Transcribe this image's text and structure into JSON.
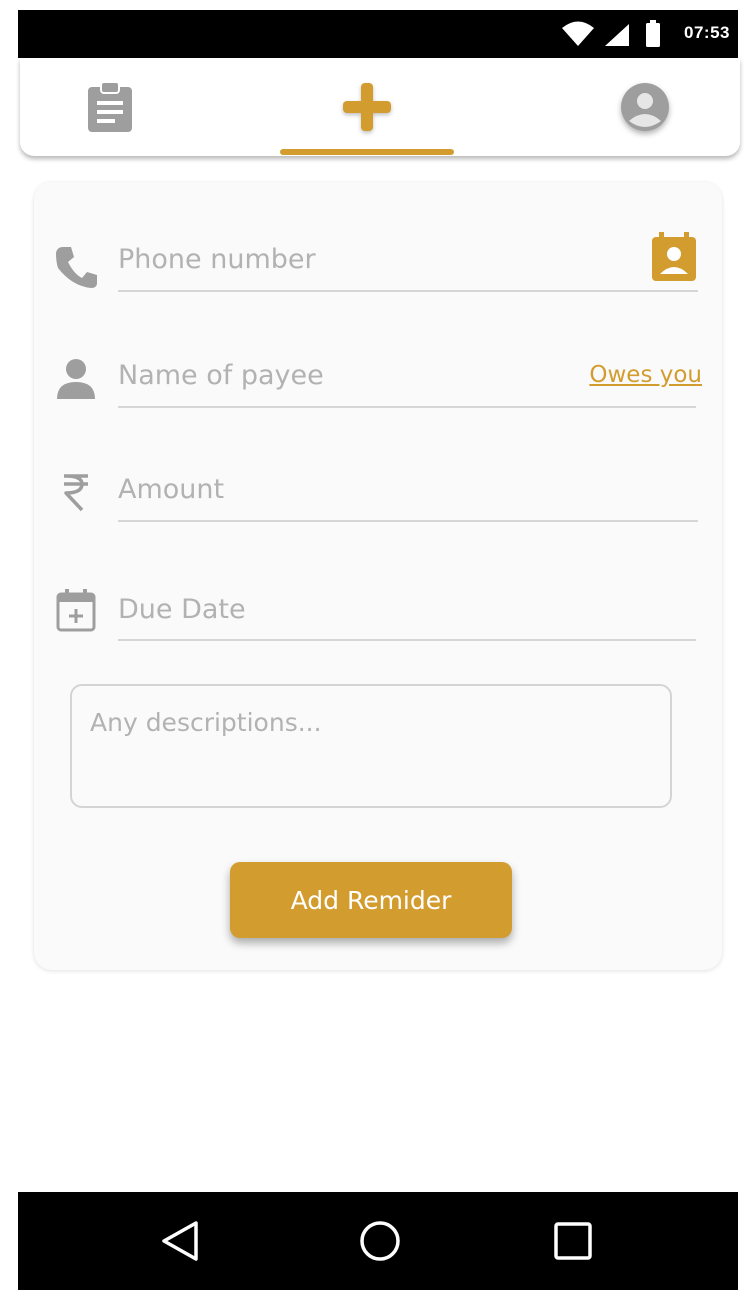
{
  "colors": {
    "accent": "#D39C2F",
    "icon_gray": "#9E9E9E",
    "placeholder": "#B2B2B2"
  },
  "status_bar": {
    "time": "07:53",
    "icons": [
      "wifi-icon",
      "signal-icon",
      "battery-icon"
    ]
  },
  "tabs": [
    {
      "name": "reminders",
      "icon": "clipboard-icon",
      "active": false
    },
    {
      "name": "add",
      "icon": "plus-icon",
      "active": true
    },
    {
      "name": "profile",
      "icon": "account-circle-icon",
      "active": false
    }
  ],
  "form": {
    "phone": {
      "placeholder": "Phone number",
      "icon": "phone-icon",
      "action_icon": "contact-book-icon"
    },
    "payee": {
      "placeholder": "Name of payee",
      "icon": "person-icon",
      "toggle_label": "Owes you"
    },
    "amount": {
      "placeholder": "Amount",
      "icon": "rupee-icon"
    },
    "due_date": {
      "placeholder": "Due Date",
      "icon": "calendar-plus-icon"
    },
    "description": {
      "placeholder": "Any descriptions..."
    },
    "submit_label": "Add Remider"
  },
  "nav_bar": {
    "buttons": [
      "back-icon",
      "home-icon",
      "recents-icon"
    ]
  }
}
